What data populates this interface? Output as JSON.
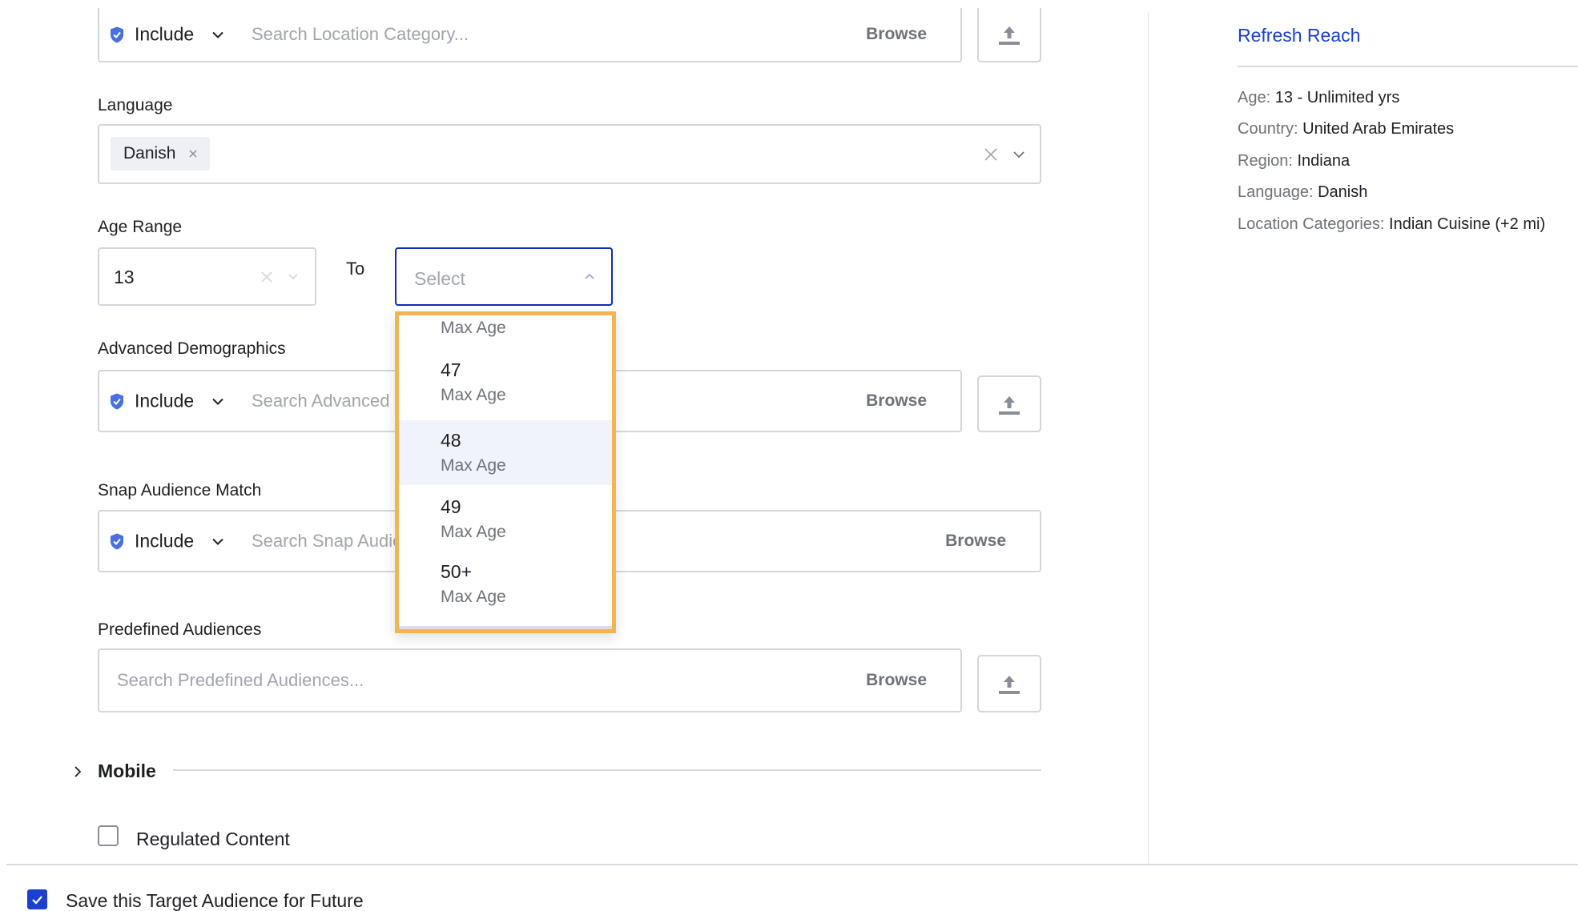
{
  "location_category": {
    "mode": "Include",
    "placeholder": "Search Location Category...",
    "browse_label": "Browse"
  },
  "language": {
    "label": "Language",
    "selected_tags": [
      "Danish"
    ]
  },
  "age_range": {
    "label": "Age Range",
    "min_value": "13",
    "to_label": "To",
    "max_placeholder": "Select",
    "dropdown": {
      "open": true,
      "options": [
        {
          "value": "",
          "sub": "Max Age"
        },
        {
          "value": "47",
          "sub": "Max Age"
        },
        {
          "value": "48",
          "sub": "Max Age",
          "highlighted": true
        },
        {
          "value": "49",
          "sub": "Max Age"
        },
        {
          "value": "50+",
          "sub": "Max Age"
        }
      ]
    }
  },
  "advanced_demographics": {
    "label": "Advanced Demographics",
    "mode": "Include",
    "placeholder": "Search Advanced Demographics...",
    "browse_label": "Browse"
  },
  "snap_audience_match": {
    "label": "Snap Audience Match",
    "mode": "Include",
    "placeholder": "Search Snap Audience Match...",
    "browse_label": "Browse"
  },
  "predefined_audiences": {
    "label": "Predefined Audiences",
    "placeholder": "Search Predefined Audiences...",
    "browse_label": "Browse"
  },
  "mobile_section": {
    "label": "Mobile",
    "expanded": false
  },
  "regulated_content": {
    "label": "Regulated Content",
    "checked": false
  },
  "save_audience": {
    "label": "Save this Target Audience for Future",
    "checked": true
  },
  "summary_panel": {
    "refresh_label": "Refresh Reach",
    "lines": [
      {
        "key": "Age:",
        "value": "13 - Unlimited yrs"
      },
      {
        "key": "Country:",
        "value": "United Arab Emirates"
      },
      {
        "key": "Region:",
        "value": "Indiana"
      },
      {
        "key": "Language:",
        "value": "Danish"
      },
      {
        "key": "Location Categories:",
        "value": "Indian Cuisine (+2 mi)"
      }
    ]
  },
  "colors": {
    "accent_blue": "#1a3fd1",
    "focus_border": "#0a2fb5",
    "highlight_border": "#f5b54e",
    "checkbox_blue": "#1a3fd1",
    "shield_blue": "#4a6fe0"
  }
}
